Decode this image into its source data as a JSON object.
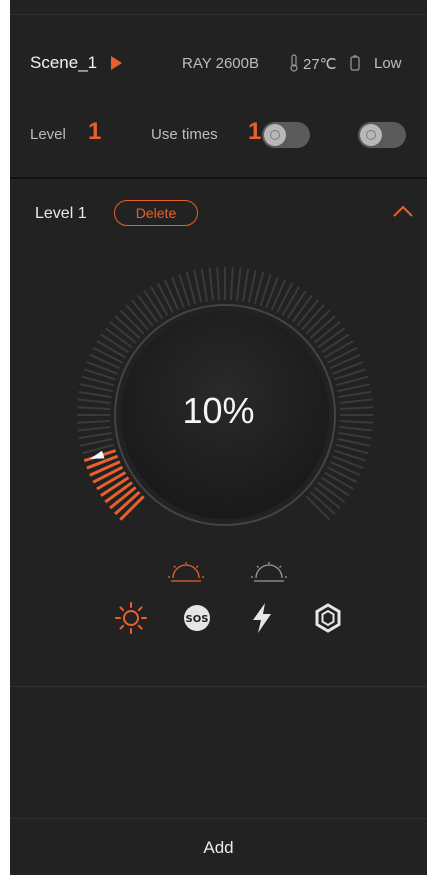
{
  "header": {
    "scene_name": "Scene_1",
    "device_name": "RAY 2600B",
    "temperature": "27℃",
    "battery_level": "Low",
    "level_label": "Level",
    "level_value": "1",
    "use_times_label": "Use times",
    "use_times_value": "1"
  },
  "level_panel": {
    "title": "Level 1",
    "delete_label": "Delete",
    "brightness_percent": "10%",
    "brightness_fraction": 0.1
  },
  "mode_icons": {
    "sub": [
      "light-1-icon",
      "light-2-icon"
    ],
    "main": [
      "sun-icon",
      "sos-icon",
      "lightning-icon",
      "shutter-icon"
    ]
  },
  "footer": {
    "add_label": "Add"
  },
  "colors": {
    "accent": "#e8612c",
    "background": "#222222",
    "text": "#e8e8e8"
  }
}
